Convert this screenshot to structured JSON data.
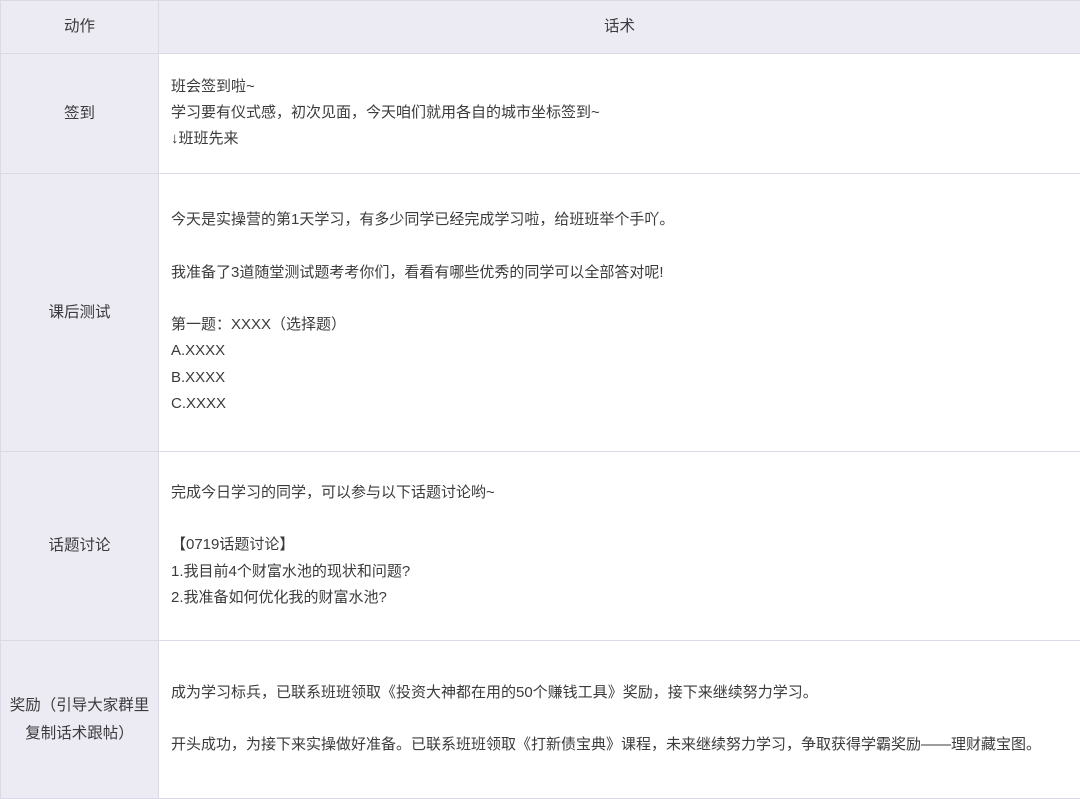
{
  "table": {
    "headers": {
      "action": "动作",
      "script": "话术"
    },
    "rows": [
      {
        "action": "签到",
        "lines": [
          {
            "text": "班会签到啦~",
            "spacer_before": false
          },
          {
            "text": "学习要有仪式感，初次见面，今天咱们就用各自的城市坐标签到~",
            "spacer_before": false
          },
          {
            "text": "↓班班先来",
            "spacer_before": false
          }
        ]
      },
      {
        "action": "课后测试",
        "lines": [
          {
            "text": "今天是实操营的第1天学习，有多少同学已经完成学习啦，给班班举个手吖。",
            "spacer_before": false
          },
          {
            "text": "我准备了3道随堂测试题考考你们，看看有哪些优秀的同学可以全部答对呢!",
            "spacer_before": true
          },
          {
            "text": "第一题：XXXX（选择题）",
            "spacer_before": true
          },
          {
            "text": "A.XXXX",
            "spacer_before": false
          },
          {
            "text": "B.XXXX",
            "spacer_before": false
          },
          {
            "text": "C.XXXX",
            "spacer_before": false
          }
        ]
      },
      {
        "action": "话题讨论",
        "lines": [
          {
            "text": "完成今日学习的同学，可以参与以下话题讨论哟~",
            "spacer_before": false
          },
          {
            "text": "【0719话题讨论】",
            "spacer_before": true
          },
          {
            "text": "1.我目前4个财富水池的现状和问题?",
            "spacer_before": false
          },
          {
            "text": "2.我准备如何优化我的财富水池?",
            "spacer_before": false
          }
        ]
      },
      {
        "action": "奖励（引导大家群里复制话术跟帖）",
        "lines": [
          {
            "text": "成为学习标兵，已联系班班领取《投资大神都在用的50个赚钱工具》奖励，接下来继续努力学习。",
            "spacer_before": false
          },
          {
            "text": "开头成功，为接下来实操做好准备。已联系班班领取《打新债宝典》课程，未来继续努力学习，争取获得学霸奖励——理财藏宝图。",
            "spacer_before": true
          }
        ]
      }
    ]
  },
  "colors": {
    "header_bg": "#ecebf4",
    "action_bg": "#ecebf4",
    "script_bg": "#ffffff",
    "border": "#dcd8e6",
    "text": "#3b3b3d"
  }
}
